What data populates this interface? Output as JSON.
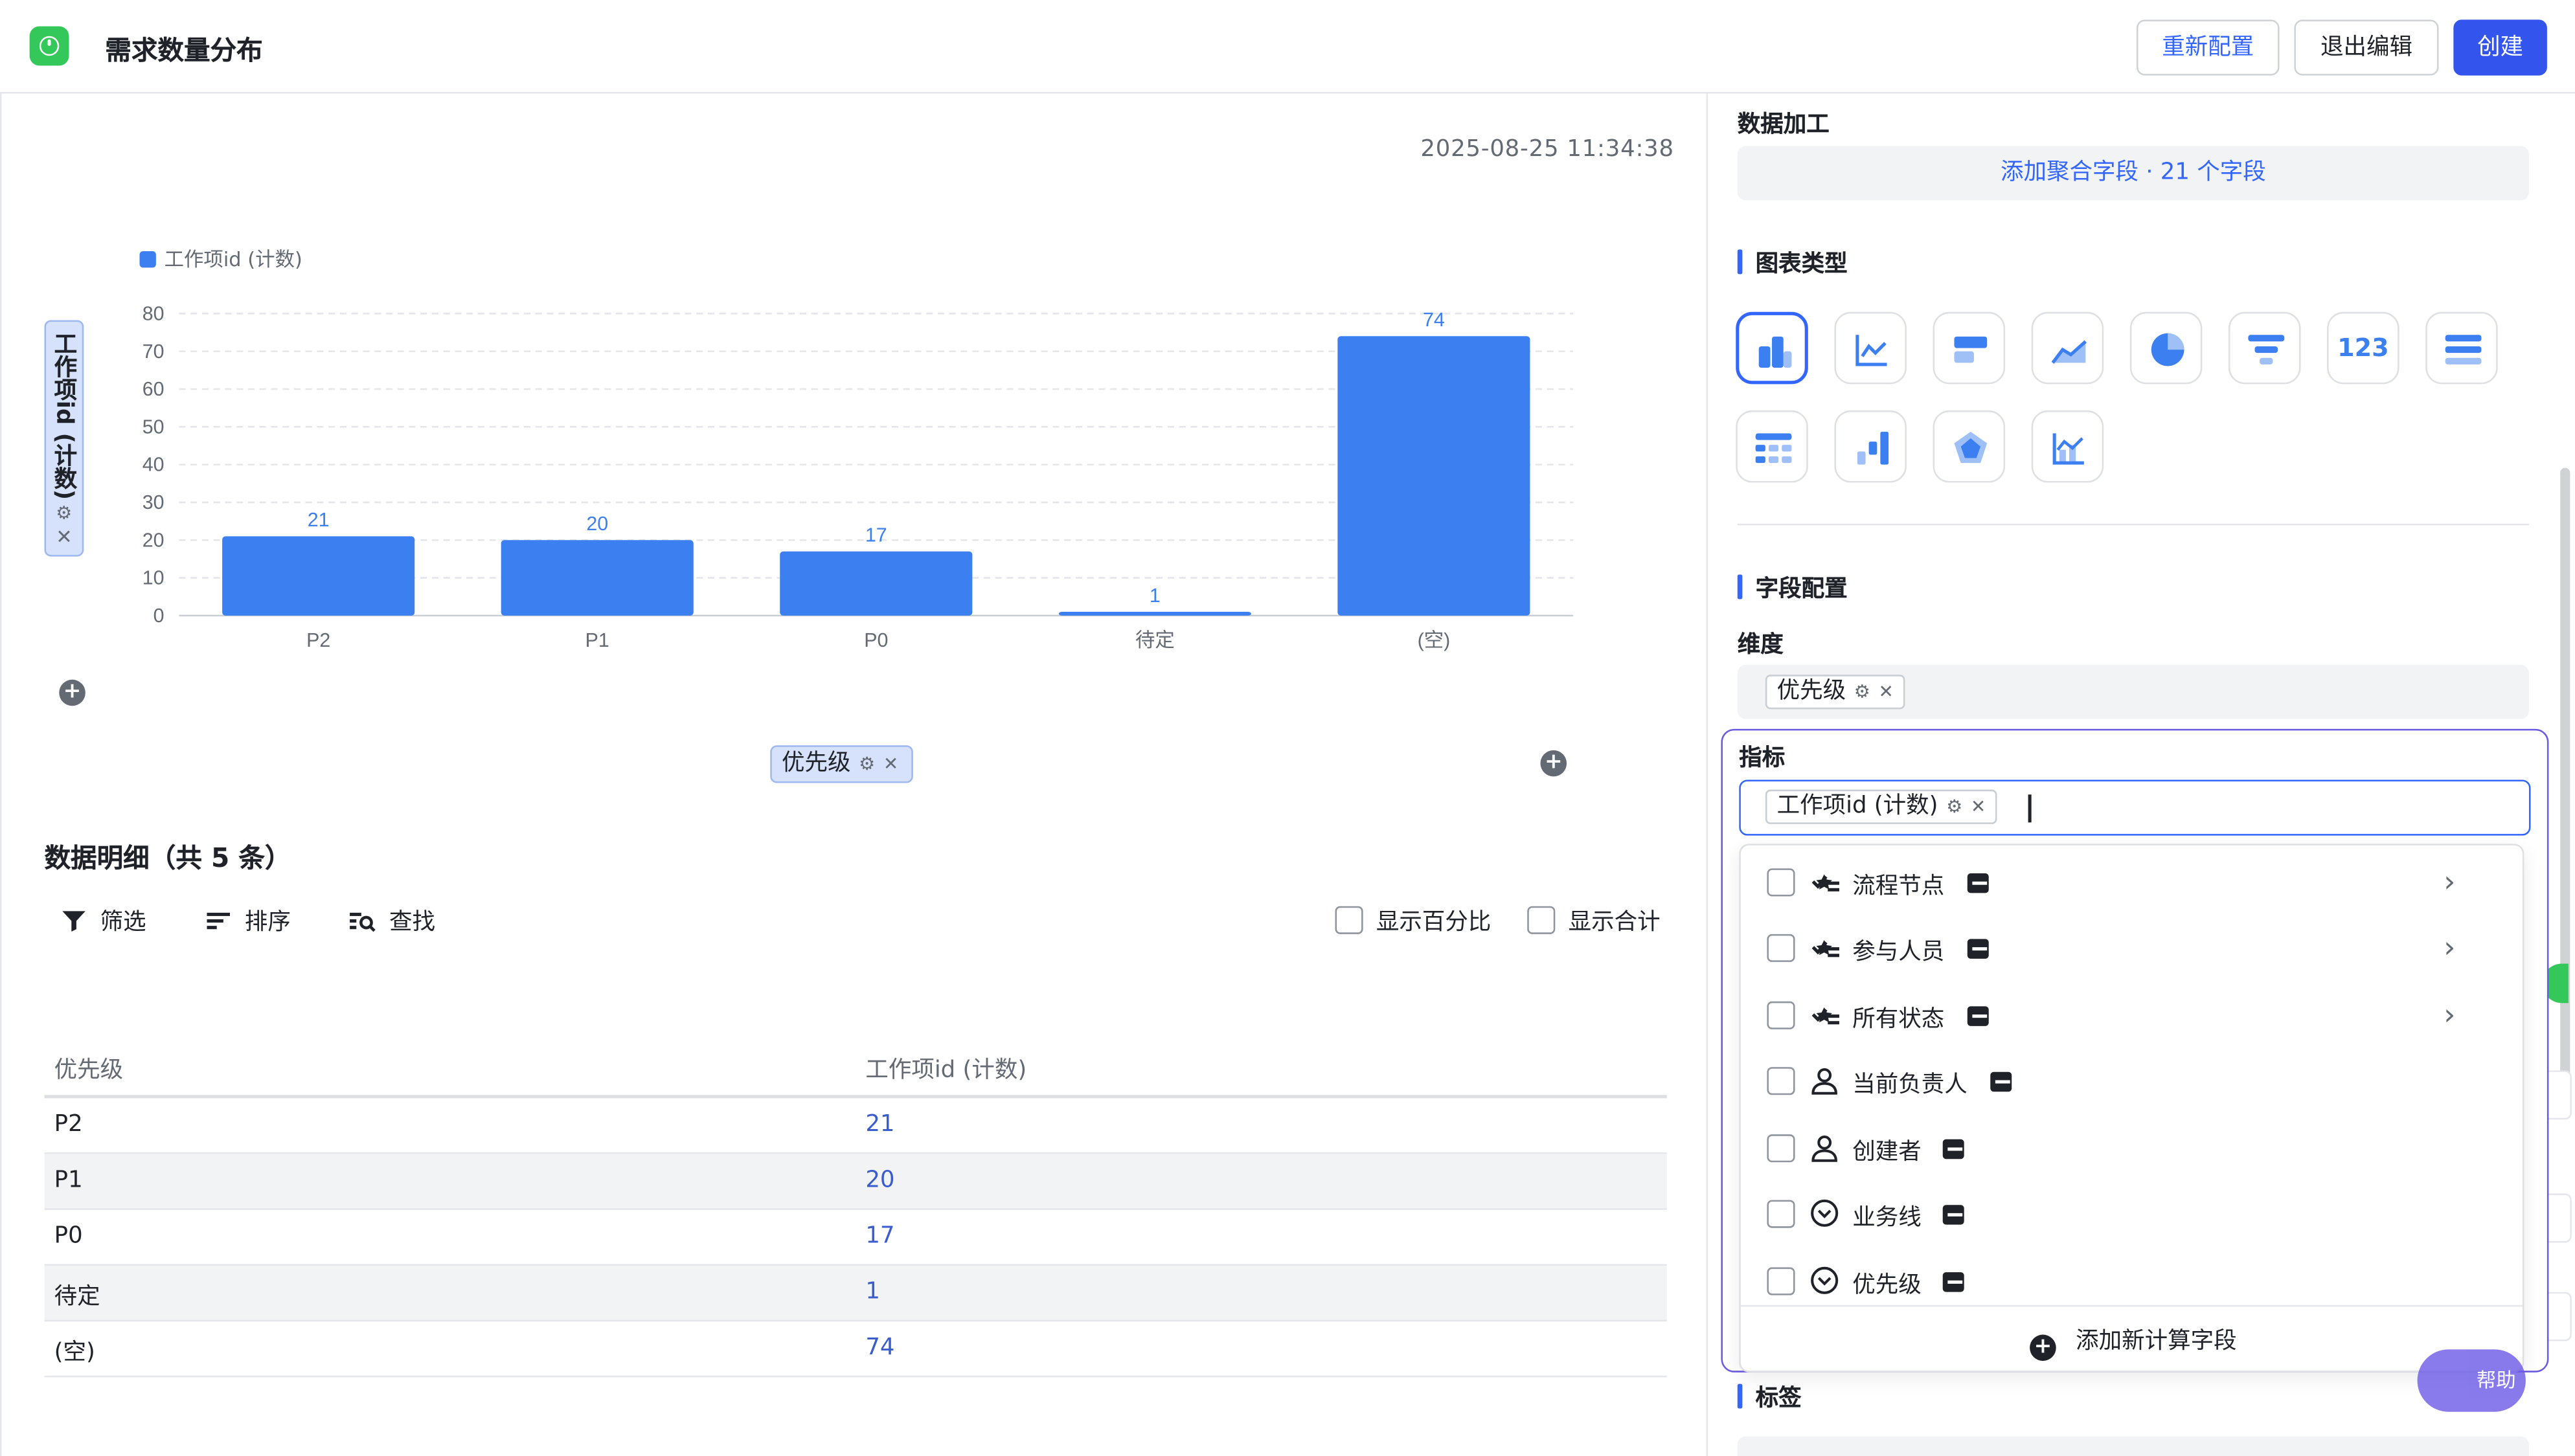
{
  "header": {
    "title": "需求数量分布",
    "buttons": {
      "reconfigure": "重新配置",
      "exit_edit": "退出编辑",
      "create": "创建"
    }
  },
  "chart_panel": {
    "timestamp": "2025-08-25 11:34:38",
    "y_field_pill": "工作项id (计数)",
    "x_field_pill": "优先级",
    "gear_glyph": "⚙",
    "close_glyph": "✕",
    "plus_glyph": "+"
  },
  "chart_data": {
    "type": "bar",
    "legend": [
      "工作项id (计数)"
    ],
    "categories": [
      "P2",
      "P1",
      "P0",
      "待定",
      "(空)"
    ],
    "series": [
      {
        "name": "工作项id (计数)",
        "values": [
          21,
          20,
          17,
          1,
          74
        ],
        "color": "#3c7ff0"
      }
    ],
    "ylim": [
      0,
      80
    ],
    "yticks": [
      0,
      10,
      20,
      30,
      40,
      50,
      60,
      70,
      80
    ],
    "data_labels": true,
    "grid": true,
    "legend_position": "top-left"
  },
  "details": {
    "title": "数据明细（共 5 条）",
    "toolbar": {
      "filter": "筛选",
      "sort": "排序",
      "find": "查找"
    },
    "options": {
      "percent": "显示百分比",
      "total": "显示合计"
    },
    "columns": [
      "优先级",
      "工作项id (计数)"
    ],
    "rows": [
      [
        "P2",
        "21"
      ],
      [
        "P1",
        "20"
      ],
      [
        "P0",
        "17"
      ],
      [
        "待定",
        "1"
      ],
      [
        "(空)",
        "74"
      ]
    ]
  },
  "config": {
    "data_processing_label": "数据加工",
    "add_aggregate": "添加聚合字段 · 21 个字段",
    "chart_type_title": "图表类型",
    "chart_types": [
      "bar-chart-icon",
      "line-chart-icon",
      "horizontal-bar-icon",
      "area-chart-icon",
      "pie-chart-icon",
      "funnel-chart-icon",
      "number-card-icon",
      "list-table-icon",
      "pivot-table-icon",
      "waterfall-chart-icon",
      "radar-chart-icon",
      "combo-chart-icon"
    ],
    "number_card_text": "123",
    "field_config_title": "字段配置",
    "dimension_label": "维度",
    "dimension_chip": "优先级",
    "metric_label": "指标",
    "metric_chip": "工作项id (计数)",
    "tags_title": "标签",
    "accent": "#3366ff"
  },
  "metric_dropdown": {
    "items": [
      {
        "label": "流程节点",
        "icon": "multi-select-icon",
        "submenu": true
      },
      {
        "label": "参与人员",
        "icon": "multi-select-icon",
        "submenu": true
      },
      {
        "label": "所有状态",
        "icon": "multi-select-icon",
        "submenu": true
      },
      {
        "label": "当前负责人",
        "icon": "person-icon",
        "submenu": false
      },
      {
        "label": "创建者",
        "icon": "person-icon",
        "submenu": false
      },
      {
        "label": "业务线",
        "icon": "dropdown-circle-icon",
        "submenu": false
      },
      {
        "label": "优先级",
        "icon": "dropdown-circle-icon",
        "submenu": false
      }
    ],
    "footer": "添加新计算字段"
  },
  "help": {
    "label": "帮助"
  }
}
